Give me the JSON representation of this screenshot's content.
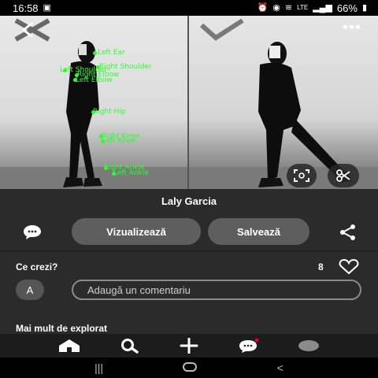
{
  "status_bar": {
    "time": "16:58",
    "battery": "66%",
    "network": "LTE"
  },
  "pin": {
    "title": "Laly Garcia"
  },
  "actions": {
    "view_label": "Vizualizează",
    "save_label": "Salvează"
  },
  "comments": {
    "heading": "Ce crezi?",
    "like_count": "8",
    "avatar_initial": "A",
    "input_placeholder": "Adaugă un comentariu"
  },
  "explore": {
    "heading": "Mai mult de explorat"
  },
  "pose_labels": [
    {
      "text": "Left Ear"
    },
    {
      "text": "Right Shoulder"
    },
    {
      "text": "Left Shoulder"
    },
    {
      "text": "Right Elbow"
    },
    {
      "text": "Left Elbow"
    },
    {
      "text": "Right Hip"
    },
    {
      "text": "Right Knee"
    },
    {
      "text": "Left Knee"
    },
    {
      "text": "Right Ankle"
    },
    {
      "text": "Left Ankle"
    }
  ],
  "bottom_nav": [
    "home-icon",
    "search-icon",
    "create-icon",
    "messages-icon",
    "profile-icon"
  ],
  "colors": {
    "sheet_bg": "#2b2b2b",
    "pill_bg": "#5e5e5e",
    "keypoint_green": "#2bff2b"
  }
}
